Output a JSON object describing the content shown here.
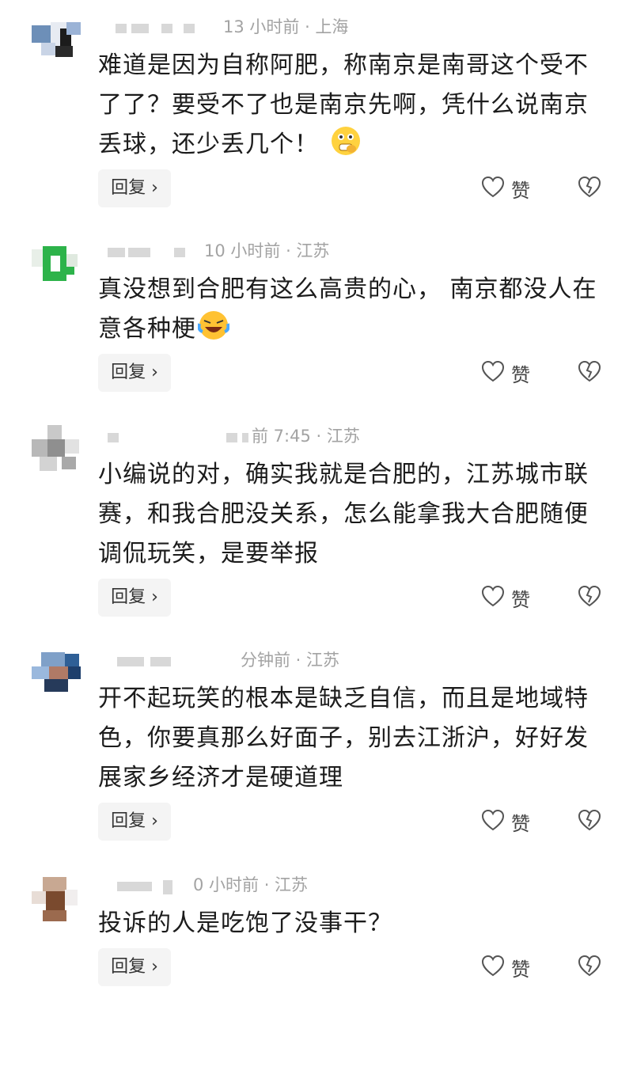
{
  "comments": [
    {
      "meta": "13 小时前 · 上海",
      "text": "难道是因为自称阿肥，称南京是南哥这个受不了了？要受不了也是南京先啊，凭什么说南京丢球，还少丢几个！",
      "emoji": "grimace-emoji",
      "reply_label": "回复 ›",
      "like_label": "赞"
    },
    {
      "meta": "10 小时前 · 江苏",
      "text": "真没想到合肥有这么高贵的心，  南京都没人在意各种梗",
      "emoji": "laughing-crying-emoji",
      "reply_label": "回复 ›",
      "like_label": "赞"
    },
    {
      "meta": "前 7:45 · 江苏",
      "text": "小编说的对，确实我就是合肥的，江苏城市联赛，和我合肥没关系，怎么能拿我大合肥随便调侃玩笑，是要举报",
      "reply_label": "回复 ›",
      "like_label": "赞"
    },
    {
      "meta": "分钟前 · 江苏",
      "text": "开不起玩笑的根本是缺乏自信，而且是地域特色，你要真那么好面子，别去江浙沪，好好发展家乡经济才是硬道理",
      "reply_label": "回复 ›",
      "like_label": "赞"
    },
    {
      "meta": "0 小时前 · 江苏",
      "text": "投诉的人是吃饱了没事干？",
      "reply_label": "回复 ›",
      "like_label": "赞"
    }
  ],
  "colors": {
    "meta": "#a3a3a3",
    "text": "#1c1c1c",
    "reply_bg": "#f4f4f4"
  }
}
